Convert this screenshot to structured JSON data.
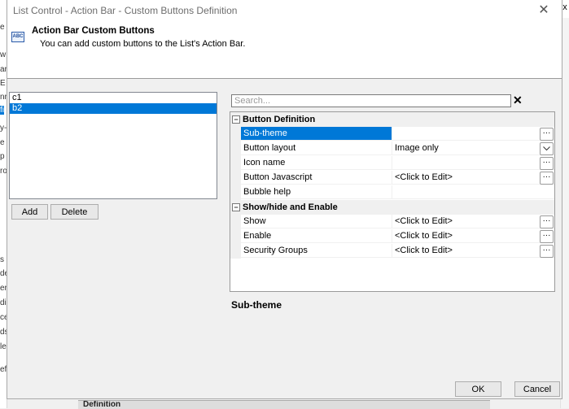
{
  "window": {
    "title": "List Control - Action Bar - Custom Buttons Definition",
    "close_glyph": "✕"
  },
  "header": {
    "icon_text": "ABC",
    "title": "Action Bar Custom Buttons",
    "subtitle": "You can add custom buttons to the List's Action Bar."
  },
  "list": {
    "items": [
      {
        "label": "c1",
        "selected": false
      },
      {
        "label": "b2",
        "selected": true
      }
    ]
  },
  "list_buttons": {
    "add": "Add",
    "delete": "Delete"
  },
  "search": {
    "placeholder": "Search...",
    "value": "",
    "clear": "✕"
  },
  "grid": {
    "collapse_glyph": "−",
    "categories": [
      {
        "label": "Button Definition",
        "rows": [
          {
            "name": "Sub-theme",
            "value": "",
            "editor": "ellipsis",
            "selected": true
          },
          {
            "name": "Button layout",
            "value": "Image only",
            "editor": "dropdown",
            "selected": false
          },
          {
            "name": "Icon name",
            "value": "",
            "editor": "ellipsis",
            "selected": false
          },
          {
            "name": "Button Javascript",
            "value": "<Click to Edit>",
            "editor": "ellipsis",
            "selected": false
          },
          {
            "name": "Bubble help",
            "value": "",
            "editor": "none",
            "selected": false
          }
        ]
      },
      {
        "label": "Show/hide and Enable",
        "rows": [
          {
            "name": "Show",
            "value": "<Click to Edit>",
            "editor": "ellipsis",
            "selected": false
          },
          {
            "name": "Enable",
            "value": "<Click to Edit>",
            "editor": "ellipsis",
            "selected": false
          },
          {
            "name": "Security Groups",
            "value": "<Click to Edit>",
            "editor": "ellipsis",
            "selected": false
          }
        ]
      }
    ]
  },
  "description": {
    "title": "Sub-theme"
  },
  "footer": {
    "ok": "OK",
    "cancel": "Cancel"
  },
  "background": {
    "left_fragments": [
      "e",
      "w",
      "ar",
      "E",
      "nr'",
      "fi",
      "y-",
      "e",
      "p",
      "ro",
      "s",
      "de",
      "er",
      "di",
      "ce",
      "ds",
      "le",
      "ef"
    ],
    "right_corner": "x",
    "bottom_fragment": "Definition"
  },
  "colors": {
    "selection": "#0078d7",
    "header_bg": "#ffffff",
    "dialog_bg": "#f0f0f0"
  }
}
